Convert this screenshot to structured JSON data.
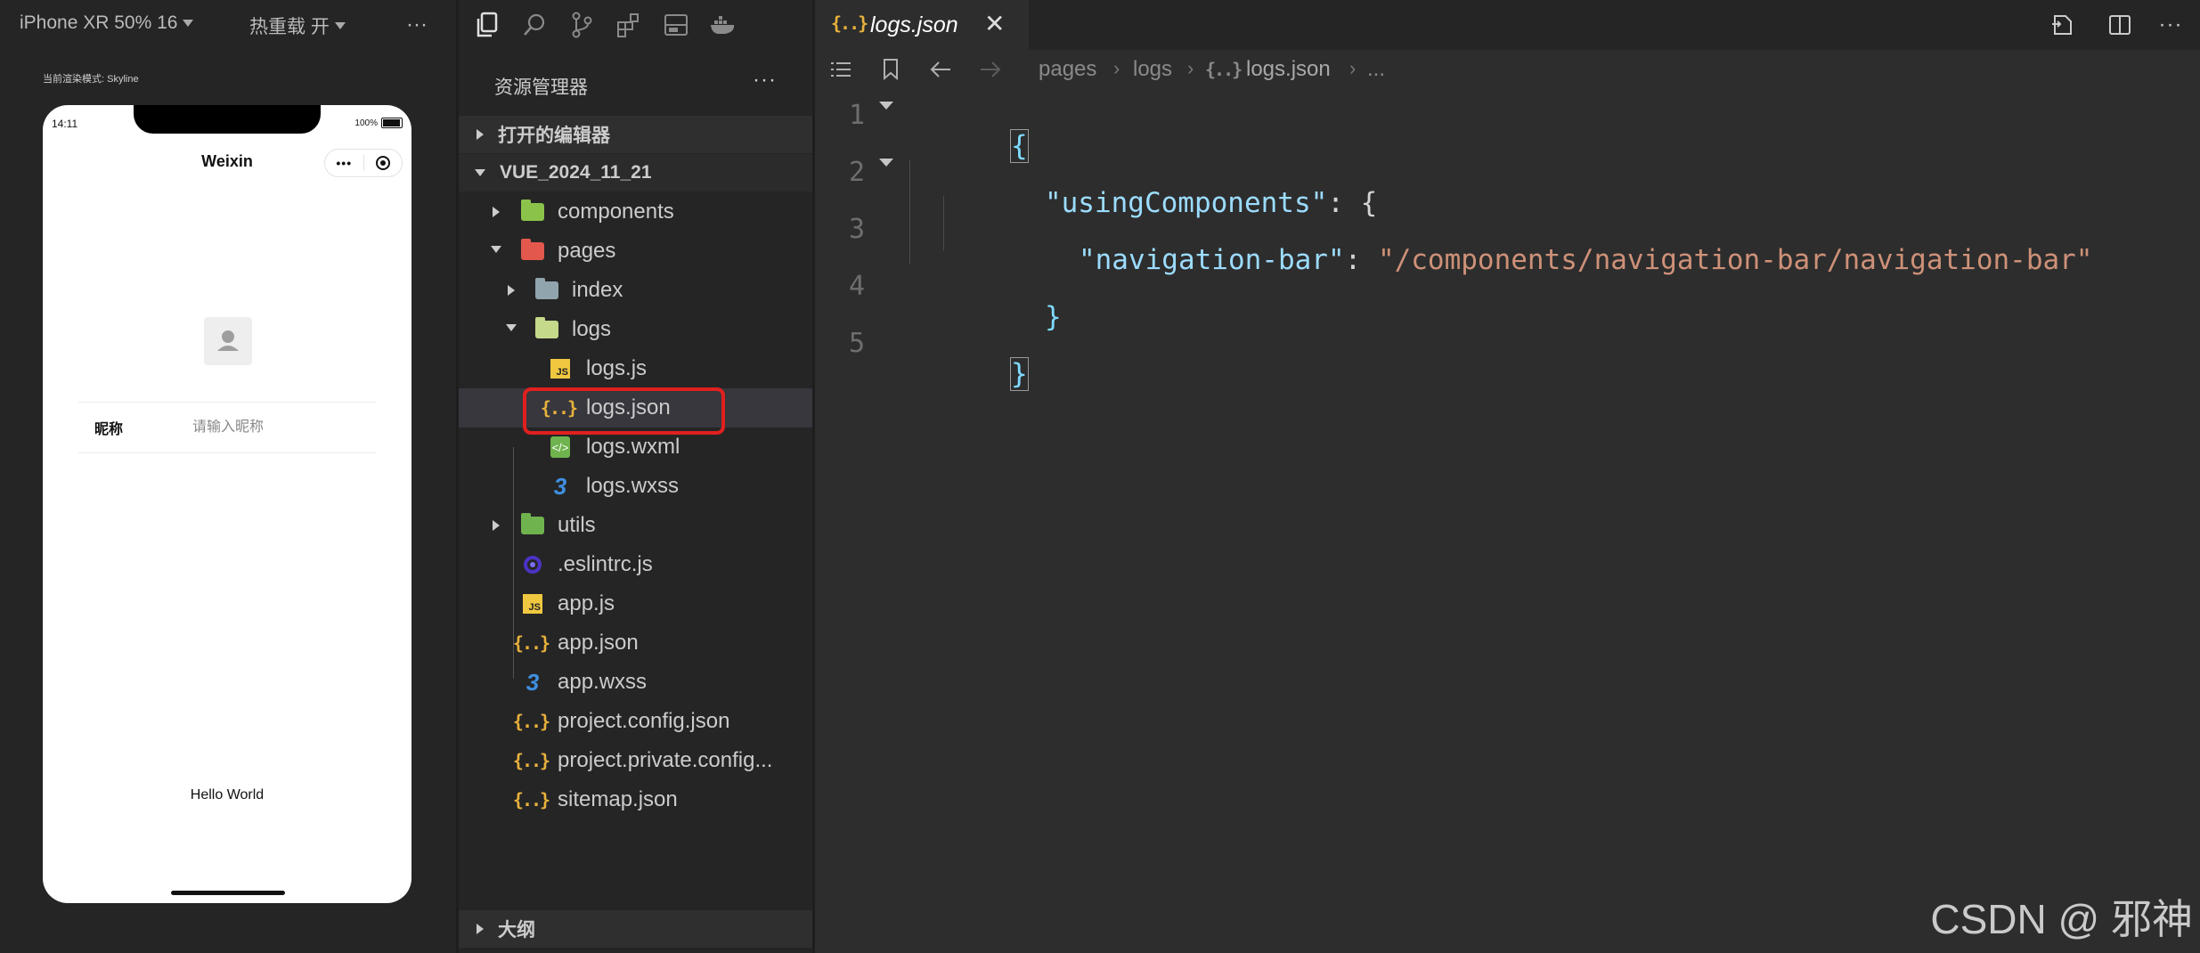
{
  "simulator": {
    "device": "iPhone XR 50% 16",
    "hot_reload": "热重载 开",
    "more": "···",
    "render_mode": "当前渲染模式: Skyline",
    "status_time": "14:11",
    "status_battery": "100%",
    "nav_title": "Weixin",
    "capsule_more": "•••",
    "capsule_close": "⦿",
    "nickname_label": "昵称",
    "nickname_placeholder": "请输入昵称",
    "hello_text": "Hello World"
  },
  "explorer": {
    "title": "资源管理器",
    "more": "···",
    "open_editors": "打开的编辑器",
    "project": "VUE_2024_11_21",
    "outline": "大纲",
    "tree": [
      {
        "label": "components",
        "type": "folder",
        "color": "#8bc34a",
        "expanded": false
      },
      {
        "label": "pages",
        "type": "folder",
        "color": "#e2584c",
        "expanded": true
      },
      {
        "label": "index",
        "type": "folder",
        "color": "#90a4ae",
        "expanded": false
      },
      {
        "label": "logs",
        "type": "folder",
        "color": "#c5d98a",
        "expanded": true
      },
      {
        "label": "logs.js",
        "type": "js"
      },
      {
        "label": "logs.json",
        "type": "json",
        "selected": true
      },
      {
        "label": "logs.wxml",
        "type": "wxml"
      },
      {
        "label": "logs.wxss",
        "type": "css"
      },
      {
        "label": "utils",
        "type": "folder",
        "color": "#6fb34e",
        "expanded": false
      },
      {
        "label": ".eslintrc.js",
        "type": "eslint"
      },
      {
        "label": "app.js",
        "type": "js"
      },
      {
        "label": "app.json",
        "type": "json"
      },
      {
        "label": "app.wxss",
        "type": "css"
      },
      {
        "label": "project.config.json",
        "type": "json"
      },
      {
        "label": "project.private.config...",
        "type": "json"
      },
      {
        "label": "sitemap.json",
        "type": "json"
      }
    ]
  },
  "editor": {
    "tab_label": "logs.json",
    "tab_close": "✕",
    "breadcrumb": [
      "pages",
      "logs",
      "logs.json",
      "..."
    ],
    "line_numbers": [
      "1",
      "2",
      "3",
      "4",
      "5"
    ],
    "code": {
      "l1": "{",
      "l2_key": "\"usingComponents\"",
      "l2_rest": ": {",
      "l3_key": "\"navigation-bar\"",
      "l3_colon": ": ",
      "l3_val": "\"/components/navigation-bar/navigation-bar\"",
      "l4": "}",
      "l5": "}"
    }
  },
  "watermark": "CSDN @  邪神",
  "colors": {
    "highlight_box": "#e0201f",
    "json_key": "#9cdcfe",
    "json_string": "#ce9178"
  }
}
